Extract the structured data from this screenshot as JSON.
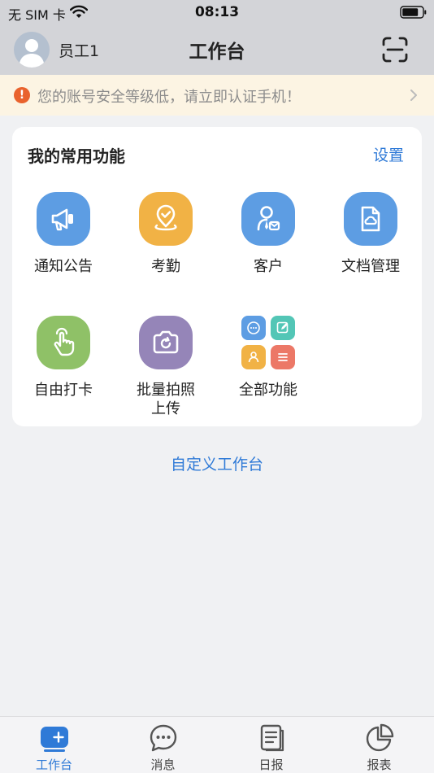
{
  "status_bar": {
    "carrier": "无 SIM 卡",
    "time": "08:13"
  },
  "nav": {
    "user_name": "员工1",
    "title": "工作台"
  },
  "alert": {
    "icon": "!",
    "text": "您的账号安全等级低，请立即认证手机！"
  },
  "card": {
    "title": "我的常用功能",
    "settings_label": "设置",
    "items": [
      {
        "label": "通知公告",
        "icon": "megaphone-icon",
        "color": "#5d9de3"
      },
      {
        "label": "考勤",
        "icon": "location-check-icon",
        "color": "#f1b245"
      },
      {
        "label": "客户",
        "icon": "customer-icon",
        "color": "#5d9de3"
      },
      {
        "label": "文档管理",
        "icon": "document-cloud-icon",
        "color": "#5d9de3"
      },
      {
        "label": "自由打卡",
        "icon": "hand-tap-icon",
        "color": "#8fc167"
      },
      {
        "label": "批量拍照\n上传",
        "label_line1": "批量拍照",
        "label_line2": "上传",
        "icon": "camera-refresh-icon",
        "color": "#9585b8"
      },
      {
        "label": "全部功能",
        "icon": "all-functions-grid-icon",
        "colors": [
          "#5d9de3",
          "#53c6b6",
          "#f1b245",
          "#ec7867"
        ]
      }
    ]
  },
  "customize_label": "自定义工作台",
  "tabs": [
    {
      "label": "工作台",
      "icon": "workbench-icon",
      "active": true
    },
    {
      "label": "消息",
      "icon": "message-icon",
      "active": false
    },
    {
      "label": "日报",
      "icon": "daily-report-icon",
      "active": false
    },
    {
      "label": "报表",
      "icon": "pie-chart-icon",
      "active": false
    }
  ],
  "colors": {
    "accent": "#2f7ad7",
    "alert": "#e9622d",
    "bar_bg": "#d3d4d8"
  }
}
